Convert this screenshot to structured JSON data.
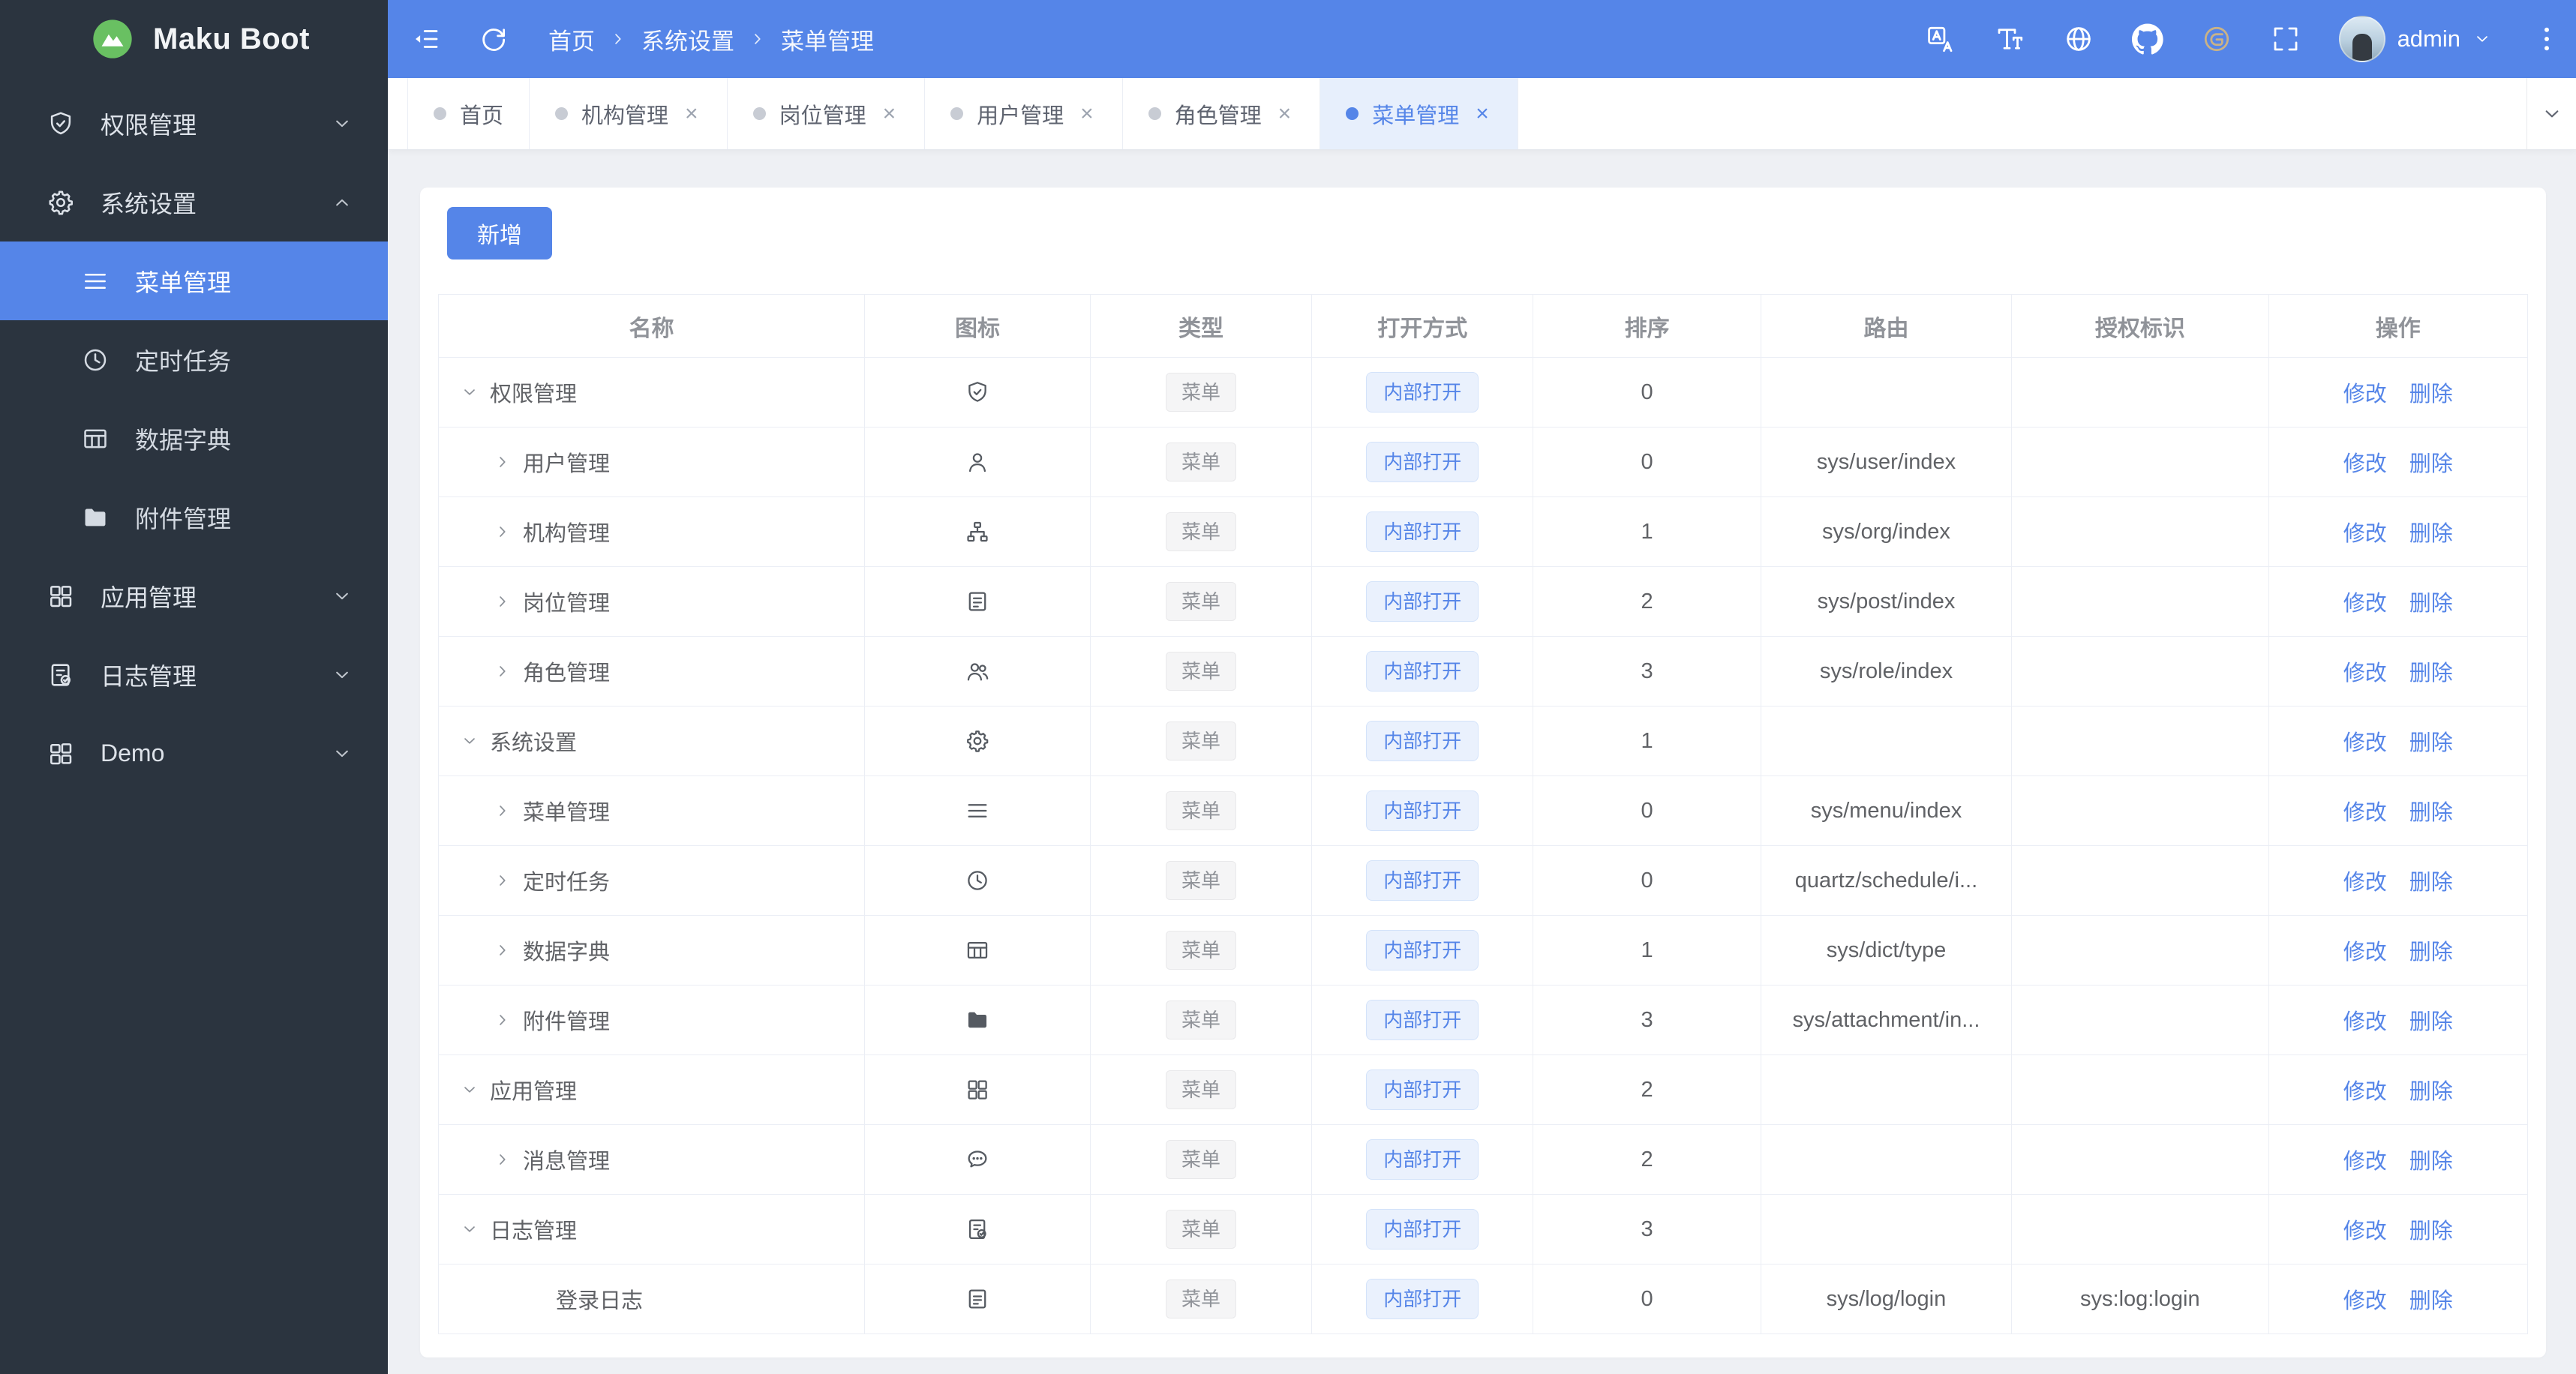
{
  "app": {
    "logo_text": "Maku Boot"
  },
  "colors": {
    "primary": "#5585e8",
    "sidebar_bg": "#2b343f",
    "content_bg": "#eef0f4",
    "tag_blue_bg": "#eaf1fd",
    "tag_gray_bg": "#f5f5f6"
  },
  "sidebar": {
    "items": [
      {
        "key": "perm",
        "label": "权限管理",
        "icon": "shield-check-icon",
        "type": "top",
        "chevron": "down"
      },
      {
        "key": "system",
        "label": "系统设置",
        "icon": "gear-icon",
        "type": "top",
        "chevron": "up"
      },
      {
        "key": "menu",
        "label": "菜单管理",
        "icon": "menu-lines-icon",
        "type": "sub",
        "active": true
      },
      {
        "key": "schedule",
        "label": "定时任务",
        "icon": "clock-icon",
        "type": "sub"
      },
      {
        "key": "dict",
        "label": "数据字典",
        "icon": "dict-table-icon",
        "type": "sub"
      },
      {
        "key": "attachment",
        "label": "附件管理",
        "icon": "folder-icon",
        "type": "sub"
      },
      {
        "key": "app",
        "label": "应用管理",
        "icon": "grid-icon",
        "type": "top",
        "chevron": "down"
      },
      {
        "key": "log",
        "label": "日志管理",
        "icon": "log-doc-icon",
        "type": "top",
        "chevron": "down"
      },
      {
        "key": "demo",
        "label": "Demo",
        "icon": "grid2-icon",
        "type": "top",
        "chevron": "down"
      }
    ]
  },
  "header": {
    "breadcrumb": [
      "首页",
      "系统设置",
      "菜单管理"
    ],
    "user": "admin",
    "icons": [
      "translate-icon",
      "font-size-icon",
      "globe-icon",
      "github-icon",
      "gitee-icon",
      "fullscreen-icon"
    ]
  },
  "tabs": [
    {
      "key": "home",
      "label": "首页",
      "closable": false,
      "active": false
    },
    {
      "key": "org",
      "label": "机构管理",
      "closable": true,
      "active": false
    },
    {
      "key": "post",
      "label": "岗位管理",
      "closable": true,
      "active": false
    },
    {
      "key": "user",
      "label": "用户管理",
      "closable": true,
      "active": false
    },
    {
      "key": "role",
      "label": "角色管理",
      "closable": true,
      "active": false
    },
    {
      "key": "menu",
      "label": "菜单管理",
      "closable": true,
      "active": true
    }
  ],
  "toolbar": {
    "add_label": "新增"
  },
  "table": {
    "headers": [
      "名称",
      "图标",
      "类型",
      "打开方式",
      "排序",
      "路由",
      "授权标识",
      "操作"
    ],
    "type_tag": "菜单",
    "open_tag": "内部打开",
    "edit_label": "修改",
    "delete_label": "删除",
    "rows": [
      {
        "name": "权限管理",
        "icon": "shield-check-icon",
        "level": 0,
        "expand": "down",
        "sort": "0",
        "route": "",
        "auth": ""
      },
      {
        "name": "用户管理",
        "icon": "user-icon",
        "level": 1,
        "expand": "right",
        "sort": "0",
        "route": "sys/user/index",
        "auth": ""
      },
      {
        "name": "机构管理",
        "icon": "org-icon",
        "level": 1,
        "expand": "right",
        "sort": "1",
        "route": "sys/org/index",
        "auth": ""
      },
      {
        "name": "岗位管理",
        "icon": "post-icon",
        "level": 1,
        "expand": "right",
        "sort": "2",
        "route": "sys/post/index",
        "auth": ""
      },
      {
        "name": "角色管理",
        "icon": "role-icon",
        "level": 1,
        "expand": "right",
        "sort": "3",
        "route": "sys/role/index",
        "auth": ""
      },
      {
        "name": "系统设置",
        "icon": "gear-icon",
        "level": 0,
        "expand": "down",
        "sort": "1",
        "route": "",
        "auth": ""
      },
      {
        "name": "菜单管理",
        "icon": "menu-lines-icon",
        "level": 1,
        "expand": "right",
        "sort": "0",
        "route": "sys/menu/index",
        "auth": ""
      },
      {
        "name": "定时任务",
        "icon": "clock-icon",
        "level": 1,
        "expand": "right",
        "sort": "0",
        "route": "quartz/schedule/i...",
        "auth": ""
      },
      {
        "name": "数据字典",
        "icon": "dict-table-icon",
        "level": 1,
        "expand": "right",
        "sort": "1",
        "route": "sys/dict/type",
        "auth": ""
      },
      {
        "name": "附件管理",
        "icon": "folder-icon",
        "level": 1,
        "expand": "right",
        "sort": "3",
        "route": "sys/attachment/in...",
        "auth": ""
      },
      {
        "name": "应用管理",
        "icon": "grid-icon",
        "level": 0,
        "expand": "down",
        "sort": "2",
        "route": "",
        "auth": ""
      },
      {
        "name": "消息管理",
        "icon": "chat-icon",
        "level": 1,
        "expand": "right",
        "sort": "2",
        "route": "",
        "auth": ""
      },
      {
        "name": "日志管理",
        "icon": "log-doc-icon",
        "level": 0,
        "expand": "down",
        "sort": "3",
        "route": "",
        "auth": ""
      },
      {
        "name": "登录日志",
        "icon": "login-log-icon",
        "level": 2,
        "expand": "none",
        "sort": "0",
        "route": "sys/log/login",
        "auth": "sys:log:login"
      }
    ]
  }
}
